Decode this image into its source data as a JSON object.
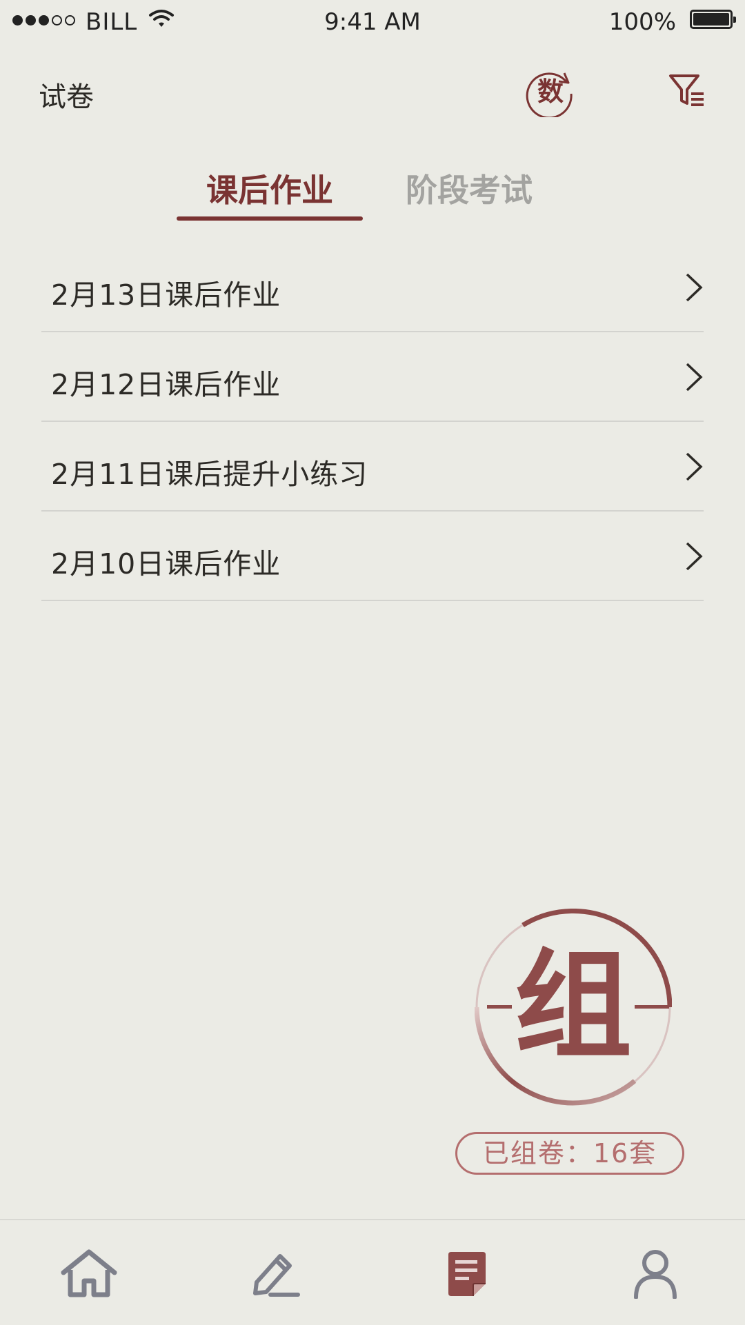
{
  "status_bar": {
    "carrier": "BILL",
    "time": "9:41 AM",
    "battery": "100%"
  },
  "header": {
    "title": "试卷",
    "subject_badge": "数",
    "subject_icon": "math-subject-icon",
    "filter_icon": "filter-icon"
  },
  "tabs": [
    {
      "label": "课后作业",
      "active": true
    },
    {
      "label": "阶段考试",
      "active": false
    }
  ],
  "papers": [
    {
      "title": "2月13日课后作业"
    },
    {
      "title": "2月12日课后作业"
    },
    {
      "title": "2月11日课后提升小练习"
    },
    {
      "title": "2月10日课后作业"
    }
  ],
  "compose": {
    "label": "组",
    "count_text": "已组卷：16套"
  },
  "bottom_nav": [
    {
      "name": "home",
      "icon": "home-icon",
      "active": false
    },
    {
      "name": "edit",
      "icon": "pencil-icon",
      "active": false
    },
    {
      "name": "papers",
      "icon": "document-icon",
      "active": true
    },
    {
      "name": "profile",
      "icon": "person-icon",
      "active": false
    }
  ],
  "colors": {
    "background": "#ebebe5",
    "accent": "#7a3332",
    "accent_light": "#b46e6e",
    "inactive": "#a3a3a0",
    "nav_icon": "#7d7f8a"
  }
}
